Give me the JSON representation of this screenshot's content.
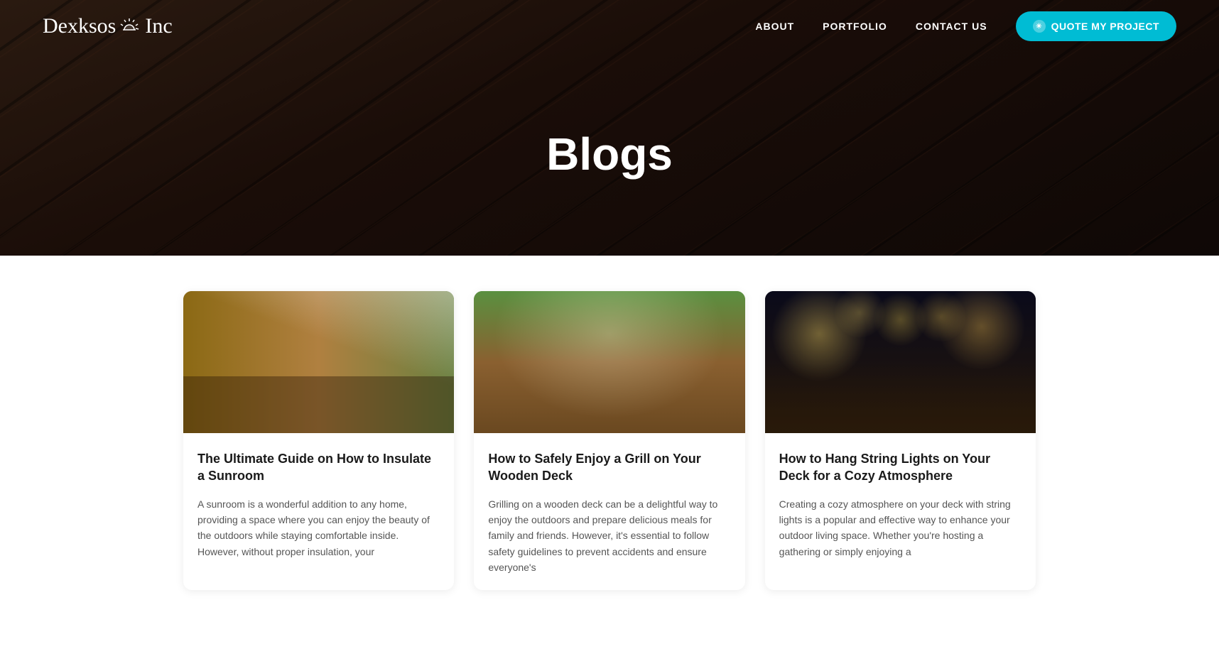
{
  "nav": {
    "logo_text_1": "Dexksos",
    "logo_text_2": "Inc",
    "links": [
      {
        "label": "ABOUT",
        "href": "#"
      },
      {
        "label": "PORTFOLIO",
        "href": "#"
      },
      {
        "label": "CONTACT US",
        "href": "#"
      }
    ],
    "cta_label": "QUOTE MY PROJECT"
  },
  "hero": {
    "title": "Blogs"
  },
  "blog": {
    "cards": [
      {
        "title": "The Ultimate Guide on How to Insulate a Sunroom",
        "excerpt": "A sunroom is a wonderful addition to any home, providing a space where you can enjoy the beauty of the outdoors while staying comfortable inside. However, without proper insulation, your",
        "image_type": "sunroom"
      },
      {
        "title": "How to Safely Enjoy a Grill on Your Wooden Deck",
        "excerpt": "Grilling on a wooden deck can be a delightful way to enjoy the outdoors and prepare delicious meals for family and friends. However, it's essential to follow safety guidelines to prevent accidents and ensure everyone's",
        "image_type": "grill"
      },
      {
        "title": "How to Hang String Lights on Your Deck for a Cozy Atmosphere",
        "excerpt": "Creating a cozy atmosphere on your deck with string lights is a popular and effective way to enhance your outdoor living space. Whether you're hosting a gathering or simply enjoying a",
        "image_type": "lights"
      }
    ]
  }
}
